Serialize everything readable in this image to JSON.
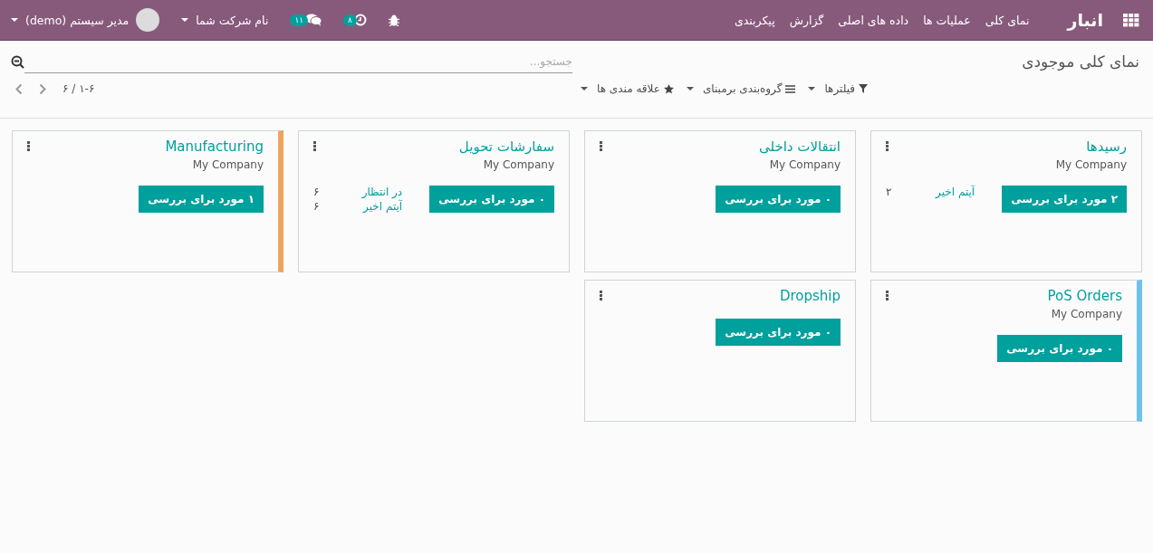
{
  "navbar": {
    "app_name": "انبار",
    "menu": [
      "نمای کلی",
      "عملیات ها",
      "داده های اصلی",
      "گزارش",
      "پیکربندی"
    ],
    "activity_count": "۸",
    "message_count": "۱۱",
    "company": "نام شرکت شما",
    "user": "مدیر سیستم (demo)"
  },
  "control_panel": {
    "title": "نمای کلی موجودی",
    "search": {
      "placeholder": "جستجو..."
    },
    "filters": [
      "فیلترها",
      "گروه‌بندی برمبنای",
      "علاقه مندی ها"
    ],
    "pager": "۱-۶ / ۶"
  },
  "cards": [
    {
      "title": "رسیدها",
      "company": "My Company",
      "button": "۲ مورد برای بررسی",
      "stats": [
        {
          "label": "آیتم اخیر",
          "value": "۲"
        }
      ]
    },
    {
      "title": "انتقالات داخلی",
      "company": "My Company",
      "button": "۰ مورد برای بررسی"
    },
    {
      "title": "سفارشات تحویل",
      "company": "My Company",
      "button": "۰ مورد برای بررسی",
      "stats": [
        {
          "label": "در انتظار",
          "value": "۶"
        },
        {
          "label": "آیتم اخیر",
          "value": "۶"
        }
      ]
    },
    {
      "title": "Manufacturing",
      "company": "My Company",
      "button": "۱ مورد برای بررسی",
      "color": "#f0a35e"
    },
    {
      "title": "PoS Orders",
      "company": "My Company",
      "button": "۰ مورد برای بررسی",
      "color": "#6cc1ed"
    },
    {
      "title": "Dropship",
      "button": "۰ مورد برای بررسی"
    }
  ]
}
